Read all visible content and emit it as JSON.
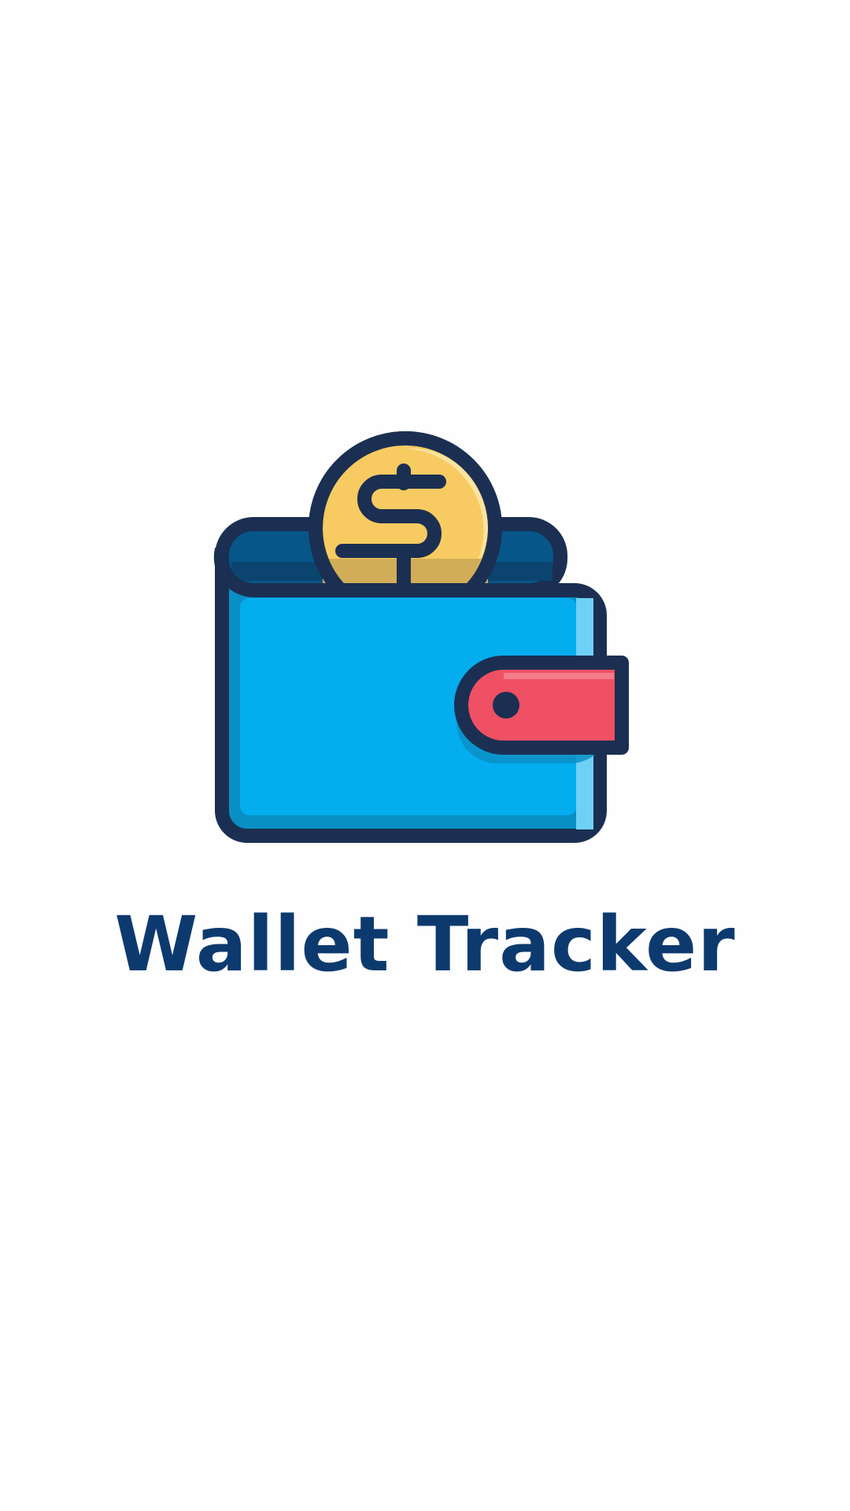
{
  "app": {
    "title": "Wallet Tracker",
    "logo_icon": "wallet-with-dollar-coin-icon"
  },
  "colors": {
    "background": "#fefefe",
    "title": "#0d3a6e",
    "outline": "#1b2f52",
    "wallet_body": "#04adee",
    "wallet_shadow": "#0a8fc4",
    "wallet_highlight": "#6fd0f5",
    "wallet_back": "#07568a",
    "coin": "#f7cb61",
    "coin_highlight": "#fbe3a0",
    "coin_shadow": "#d2ad58",
    "clasp": "#ef5063",
    "clasp_highlight": "#f47c88"
  }
}
